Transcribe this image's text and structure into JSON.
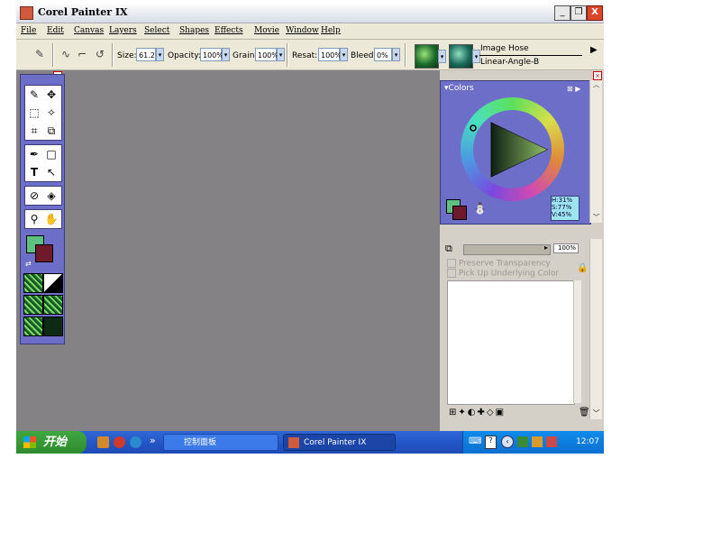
{
  "window": {
    "title": "Corel Painter IX",
    "min_label": "_",
    "max_label": "❐",
    "close_label": "X"
  },
  "menu": {
    "items": [
      "File",
      "Edit",
      "Canvas",
      "Layers",
      "Select",
      "Shapes",
      "Effects",
      "Movie",
      "Window",
      "Help"
    ]
  },
  "property_bar": {
    "size_label": "Size:",
    "size_value": "61.2",
    "opacity_label": "Opacity:",
    "opacity_value": "100%",
    "grain_label": "Grain:",
    "grain_value": "100%",
    "resat_label": "Resat:",
    "resat_value": "100%",
    "bleed_label": "Bleed:",
    "bleed_value": "0%",
    "brush_category": "Image Hose",
    "brush_variant": "Linear-Angle-B"
  },
  "colors_panel": {
    "title": "Colors",
    "hsv": {
      "h": "H:31%",
      "s": "S:77%",
      "v": "V:45%"
    },
    "hue_ring": "hue wheel with green-to-magenta gradient"
  },
  "layers_panel": {
    "composite_depth": "100%",
    "preserve_transparency": "Preserve Transparency",
    "pick_underlying": "Pick Up Underlying Color"
  },
  "taskbar": {
    "start_label": "开始",
    "quick_launch_chevron": "»",
    "tasks": [
      {
        "label": "控制面板",
        "active": false
      },
      {
        "label": "Corel Painter IX",
        "active": true
      }
    ],
    "clock": "12:07"
  },
  "colors": {
    "main_color": "#5cc07e",
    "additional_color": "#6e1a2a",
    "panel_blue": "#6d6ec8",
    "workspace_gray": "#848284"
  }
}
